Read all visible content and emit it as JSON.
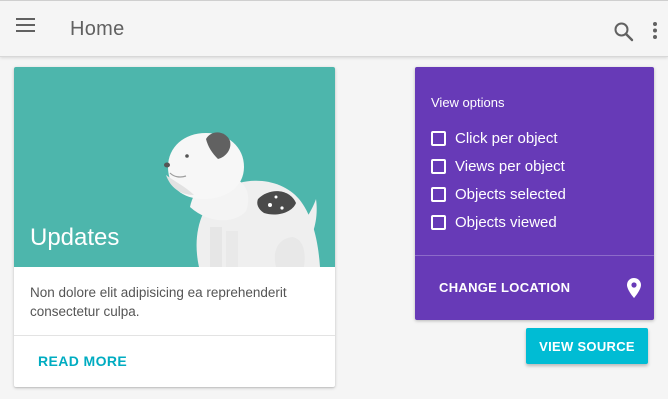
{
  "app": {
    "title": "Home"
  },
  "icons": {
    "menu": "menu-icon",
    "search": "search-icon",
    "more": "more-vert-icon",
    "location": "location-pin-icon"
  },
  "card": {
    "title": "Updates",
    "text": "Non dolore elit adipisicing ea reprehenderit consectetur culpa.",
    "action": "READ MORE",
    "media_color": "#4db6ac"
  },
  "options": {
    "heading": "View options",
    "items": [
      {
        "label": "Click per object",
        "checked": false
      },
      {
        "label": "Views per object",
        "checked": false
      },
      {
        "label": "Objects selected",
        "checked": false
      },
      {
        "label": "Objects viewed",
        "checked": false
      }
    ],
    "action": "CHANGE LOCATION",
    "color": "#673ab7"
  },
  "view_source": {
    "label": "VIEW SOURCE",
    "color": "#00bcd4"
  },
  "colors": {
    "accent": "#00acc1",
    "background": "#f5f5f5"
  }
}
